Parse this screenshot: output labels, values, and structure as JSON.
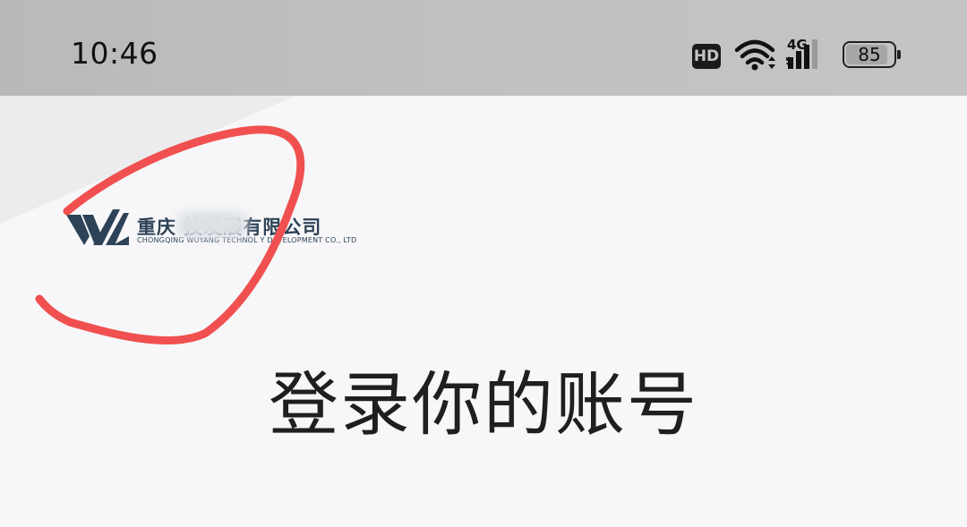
{
  "status_bar": {
    "time": "10:46",
    "hd_label": "HD",
    "network_type": "4G",
    "battery_percent": "85",
    "battery_level": 0.85
  },
  "logo": {
    "company_name_cn": "重庆 技发展有限公司",
    "company_name_en": "CHONGQING WUYANG TECHNOL    Y DEVELOPMENT CO., LTD"
  },
  "main": {
    "title": "登录你的账号"
  },
  "colors": {
    "status_bar_bg": "#c2c2c4",
    "page_bg": "#f7f7f9",
    "logo_blue": "#2d4256",
    "annotation_red": "#f0504f"
  },
  "icons": {
    "wifi": "wifi-icon",
    "signal": "signal-icon",
    "battery": "battery-icon",
    "logo_mark": "logo-mark-icon"
  }
}
